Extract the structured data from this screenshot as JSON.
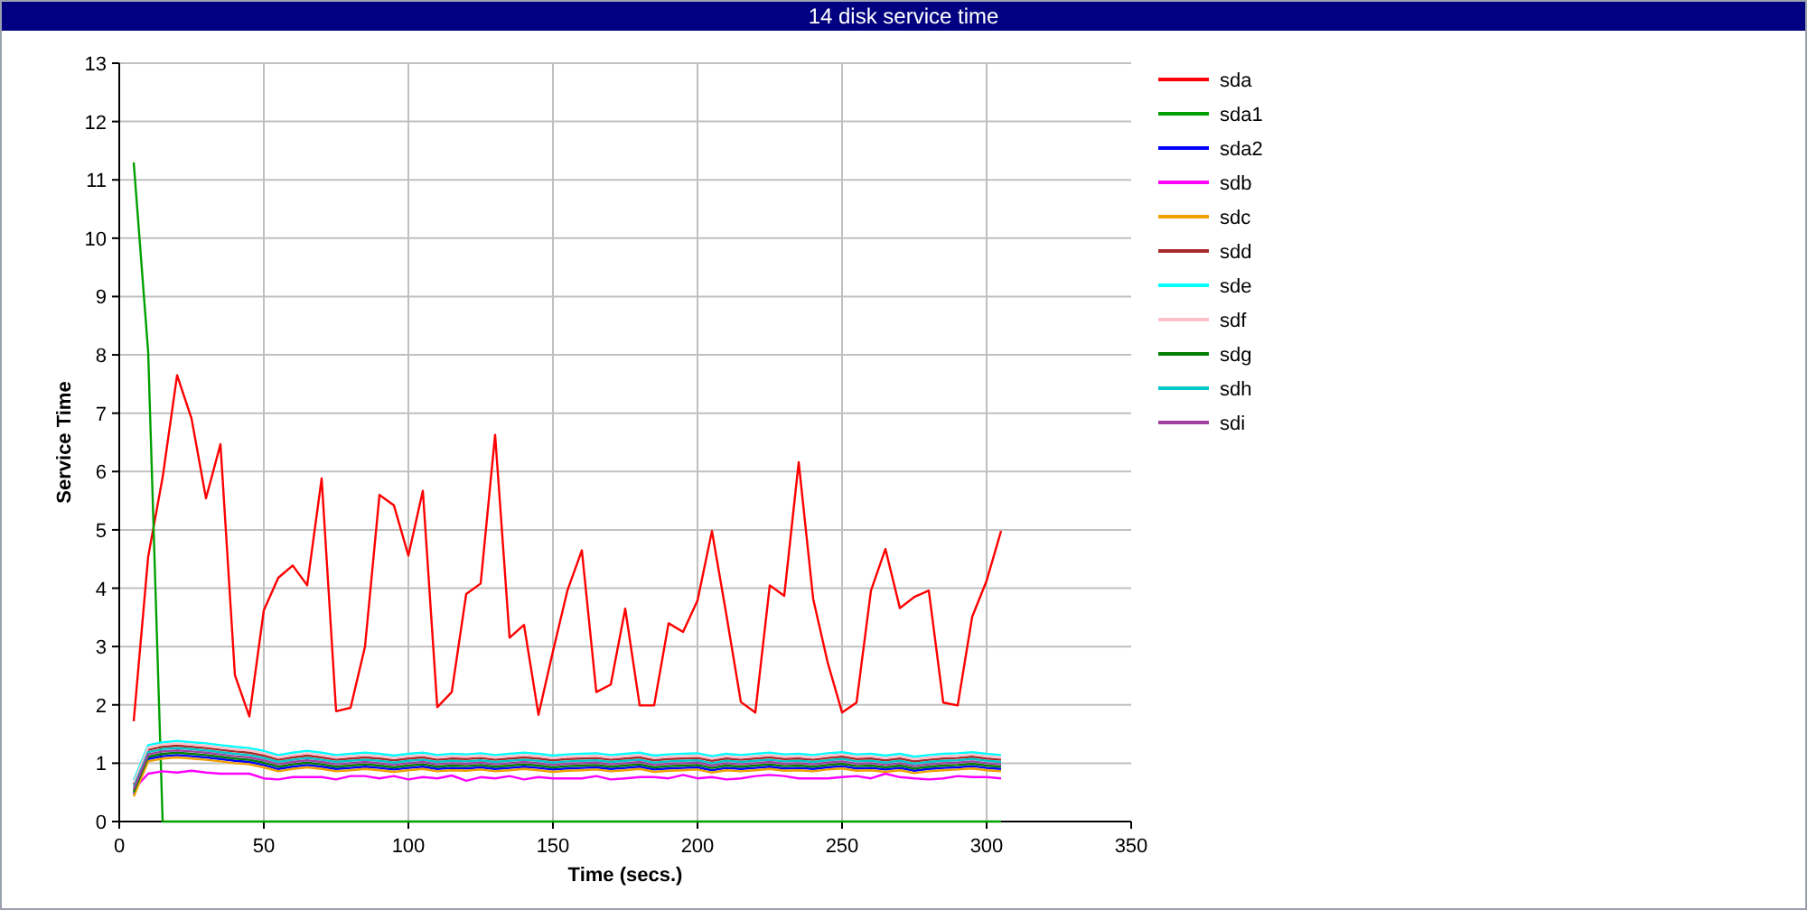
{
  "window": {
    "title": "14 disk service time"
  },
  "chart": {
    "chart_data": {
      "type": "line",
      "xlabel": "Time (secs.)",
      "ylabel": "Service Time",
      "xlim": [
        0,
        350
      ],
      "ylim": [
        0,
        13
      ],
      "xticks": [
        0,
        50,
        100,
        150,
        200,
        250,
        300,
        350
      ],
      "yticks": [
        0,
        1,
        2,
        3,
        4,
        5,
        6,
        7,
        8,
        9,
        10,
        11,
        12,
        13
      ],
      "grid": true,
      "legend": true,
      "x": [
        5,
        10,
        15,
        20,
        25,
        30,
        35,
        40,
        45,
        50,
        55,
        60,
        65,
        70,
        75,
        80,
        85,
        90,
        95,
        100,
        105,
        110,
        115,
        120,
        125,
        130,
        135,
        140,
        145,
        150,
        155,
        160,
        165,
        170,
        175,
        180,
        185,
        190,
        195,
        200,
        205,
        210,
        215,
        220,
        225,
        230,
        235,
        240,
        245,
        250,
        255,
        260,
        265,
        270,
        275,
        280,
        285,
        290,
        295,
        300,
        305
      ],
      "series": [
        {
          "name": "sda",
          "color": "#ff0000",
          "values": [
            1.72,
            4.54,
            5.9,
            7.65,
            6.91,
            5.54,
            6.47,
            2.51,
            1.8,
            3.62,
            4.18,
            4.39,
            4.05,
            5.88,
            1.89,
            1.95,
            3.0,
            5.6,
            5.42,
            4.56,
            5.67,
            1.96,
            2.22,
            3.9,
            4.08,
            6.63,
            3.15,
            3.37,
            1.83,
            2.92,
            3.96,
            4.65,
            2.22,
            2.35,
            3.65,
            1.99,
            1.99,
            3.4,
            3.25,
            3.79,
            4.98,
            3.54,
            2.05,
            1.87,
            4.05,
            3.87,
            6.16,
            3.82,
            2.73,
            1.87,
            2.04,
            3.96,
            4.67,
            3.66,
            3.85,
            3.96,
            2.04,
            1.99,
            3.51,
            4.13,
            4.98
          ]
        },
        {
          "name": "sda1",
          "color": "#00a000",
          "values": [
            11.3,
            8.05,
            0,
            0,
            0,
            0,
            0,
            0,
            0,
            0,
            0,
            0,
            0,
            0,
            0,
            0,
            0,
            0,
            0,
            0,
            0,
            0,
            0,
            0,
            0,
            0,
            0,
            0,
            0,
            0,
            0,
            0,
            0,
            0,
            0,
            0,
            0,
            0,
            0,
            0,
            0,
            0,
            0,
            0,
            0,
            0,
            0,
            0,
            0,
            0,
            0,
            0,
            0,
            0,
            0,
            0,
            0,
            0,
            0,
            0,
            0
          ]
        },
        {
          "name": "sda2",
          "color": "#0000ff",
          "values": [
            0.47,
            1.07,
            1.12,
            1.14,
            1.12,
            1.1,
            1.07,
            1.04,
            1.02,
            0.97,
            0.9,
            0.94,
            0.97,
            0.94,
            0.9,
            0.92,
            0.94,
            0.92,
            0.89,
            0.92,
            0.94,
            0.9,
            0.92,
            0.91,
            0.93,
            0.9,
            0.92,
            0.94,
            0.92,
            0.89,
            0.91,
            0.92,
            0.93,
            0.9,
            0.92,
            0.94,
            0.89,
            0.91,
            0.92,
            0.93,
            0.88,
            0.92,
            0.9,
            0.92,
            0.94,
            0.91,
            0.92,
            0.9,
            0.93,
            0.95,
            0.91,
            0.92,
            0.89,
            0.92,
            0.87,
            0.9,
            0.92,
            0.93,
            0.95,
            0.92,
            0.9
          ]
        },
        {
          "name": "sdb",
          "color": "#ff00ff",
          "values": [
            0.55,
            0.82,
            0.86,
            0.84,
            0.87,
            0.84,
            0.82,
            0.82,
            0.82,
            0.74,
            0.72,
            0.76,
            0.76,
            0.76,
            0.72,
            0.78,
            0.78,
            0.74,
            0.78,
            0.72,
            0.76,
            0.74,
            0.79,
            0.7,
            0.76,
            0.74,
            0.78,
            0.72,
            0.76,
            0.74,
            0.74,
            0.74,
            0.78,
            0.72,
            0.74,
            0.76,
            0.76,
            0.74,
            0.8,
            0.74,
            0.76,
            0.72,
            0.74,
            0.78,
            0.8,
            0.78,
            0.74,
            0.74,
            0.74,
            0.76,
            0.78,
            0.74,
            0.82,
            0.76,
            0.74,
            0.72,
            0.74,
            0.78,
            0.76,
            0.76,
            0.74
          ]
        },
        {
          "name": "sdc",
          "color": "#f0a000",
          "values": [
            0.43,
            1.03,
            1.08,
            1.1,
            1.08,
            1.06,
            1.03,
            1.0,
            0.98,
            0.93,
            0.86,
            0.9,
            0.93,
            0.9,
            0.86,
            0.88,
            0.9,
            0.88,
            0.85,
            0.88,
            0.9,
            0.86,
            0.88,
            0.87,
            0.89,
            0.86,
            0.88,
            0.9,
            0.88,
            0.85,
            0.87,
            0.88,
            0.89,
            0.86,
            0.88,
            0.9,
            0.85,
            0.87,
            0.88,
            0.89,
            0.84,
            0.88,
            0.86,
            0.88,
            0.9,
            0.87,
            0.88,
            0.86,
            0.89,
            0.91,
            0.87,
            0.88,
            0.85,
            0.88,
            0.83,
            0.86,
            0.88,
            0.89,
            0.91,
            0.88,
            0.86
          ]
        },
        {
          "name": "sdd",
          "color": "#a52a2a",
          "values": [
            0.63,
            1.23,
            1.28,
            1.3,
            1.28,
            1.26,
            1.23,
            1.2,
            1.18,
            1.13,
            1.06,
            1.1,
            1.13,
            1.1,
            1.06,
            1.08,
            1.1,
            1.08,
            1.05,
            1.08,
            1.1,
            1.06,
            1.08,
            1.07,
            1.09,
            1.06,
            1.08,
            1.1,
            1.08,
            1.05,
            1.07,
            1.08,
            1.09,
            1.06,
            1.08,
            1.1,
            1.05,
            1.07,
            1.08,
            1.09,
            1.04,
            1.08,
            1.06,
            1.08,
            1.1,
            1.07,
            1.08,
            1.06,
            1.09,
            1.11,
            1.07,
            1.08,
            1.05,
            1.08,
            1.03,
            1.06,
            1.08,
            1.09,
            1.11,
            1.08,
            1.06
          ]
        },
        {
          "name": "sde",
          "color": "#00ffff",
          "values": [
            0.71,
            1.31,
            1.36,
            1.38,
            1.36,
            1.34,
            1.31,
            1.28,
            1.26,
            1.21,
            1.14,
            1.18,
            1.21,
            1.18,
            1.14,
            1.16,
            1.18,
            1.16,
            1.13,
            1.16,
            1.18,
            1.14,
            1.16,
            1.15,
            1.17,
            1.14,
            1.16,
            1.18,
            1.16,
            1.13,
            1.15,
            1.16,
            1.17,
            1.14,
            1.16,
            1.18,
            1.13,
            1.15,
            1.16,
            1.17,
            1.12,
            1.16,
            1.14,
            1.16,
            1.18,
            1.15,
            1.16,
            1.14,
            1.17,
            1.19,
            1.15,
            1.16,
            1.13,
            1.16,
            1.11,
            1.14,
            1.16,
            1.17,
            1.19,
            1.16,
            1.14
          ]
        },
        {
          "name": "sdf",
          "color": "#ffc0cb",
          "values": [
            0.67,
            1.27,
            1.32,
            1.34,
            1.32,
            1.3,
            1.27,
            1.24,
            1.22,
            1.17,
            1.1,
            1.14,
            1.17,
            1.14,
            1.1,
            1.12,
            1.14,
            1.12,
            1.09,
            1.12,
            1.14,
            1.1,
            1.12,
            1.11,
            1.13,
            1.1,
            1.12,
            1.14,
            1.12,
            1.09,
            1.11,
            1.12,
            1.13,
            1.1,
            1.12,
            1.14,
            1.09,
            1.11,
            1.12,
            1.13,
            1.08,
            1.12,
            1.1,
            1.12,
            1.14,
            1.11,
            1.12,
            1.1,
            1.13,
            1.15,
            1.11,
            1.12,
            1.09,
            1.12,
            1.07,
            1.1,
            1.12,
            1.13,
            1.15,
            1.12,
            1.1
          ]
        },
        {
          "name": "sdg",
          "color": "#008000",
          "values": [
            0.51,
            1.11,
            1.16,
            1.18,
            1.16,
            1.14,
            1.11,
            1.08,
            1.06,
            1.01,
            0.94,
            0.98,
            1.01,
            0.98,
            0.94,
            0.96,
            0.98,
            0.96,
            0.93,
            0.96,
            0.98,
            0.94,
            0.96,
            0.95,
            0.97,
            0.94,
            0.96,
            0.98,
            0.96,
            0.93,
            0.95,
            0.96,
            0.97,
            0.94,
            0.96,
            0.98,
            0.93,
            0.95,
            0.96,
            0.97,
            0.92,
            0.96,
            0.94,
            0.96,
            0.98,
            0.95,
            0.96,
            0.94,
            0.97,
            0.99,
            0.95,
            0.96,
            0.93,
            0.96,
            0.91,
            0.94,
            0.96,
            0.97,
            0.99,
            0.96,
            0.94
          ]
        },
        {
          "name": "sdh",
          "color": "#00c8c8",
          "values": [
            0.59,
            1.19,
            1.24,
            1.26,
            1.24,
            1.22,
            1.19,
            1.16,
            1.14,
            1.09,
            1.02,
            1.06,
            1.09,
            1.06,
            1.02,
            1.04,
            1.06,
            1.04,
            1.01,
            1.04,
            1.06,
            1.02,
            1.04,
            1.03,
            1.05,
            1.02,
            1.04,
            1.06,
            1.04,
            1.01,
            1.03,
            1.04,
            1.05,
            1.02,
            1.04,
            1.06,
            1.01,
            1.03,
            1.04,
            1.05,
            1.0,
            1.04,
            1.02,
            1.04,
            1.06,
            1.03,
            1.04,
            1.02,
            1.05,
            1.07,
            1.03,
            1.04,
            1.01,
            1.04,
            0.99,
            1.02,
            1.04,
            1.05,
            1.07,
            1.04,
            1.02
          ]
        },
        {
          "name": "sdi",
          "color": "#a040a0",
          "values": [
            0.55,
            1.15,
            1.2,
            1.22,
            1.2,
            1.18,
            1.15,
            1.12,
            1.1,
            1.05,
            0.98,
            1.02,
            1.05,
            1.02,
            0.98,
            1.0,
            1.02,
            1.0,
            0.97,
            1.0,
            1.02,
            0.98,
            1.0,
            0.99,
            1.01,
            0.98,
            1.0,
            1.02,
            1.0,
            0.97,
            0.99,
            1.0,
            1.01,
            0.98,
            1.0,
            1.02,
            0.97,
            0.99,
            1.0,
            1.01,
            0.96,
            1.0,
            0.98,
            1.0,
            1.02,
            0.99,
            1.0,
            0.98,
            1.01,
            1.03,
            0.99,
            1.0,
            0.97,
            1.0,
            0.95,
            0.98,
            1.0,
            1.01,
            1.03,
            1.0,
            0.98
          ]
        }
      ]
    }
  }
}
